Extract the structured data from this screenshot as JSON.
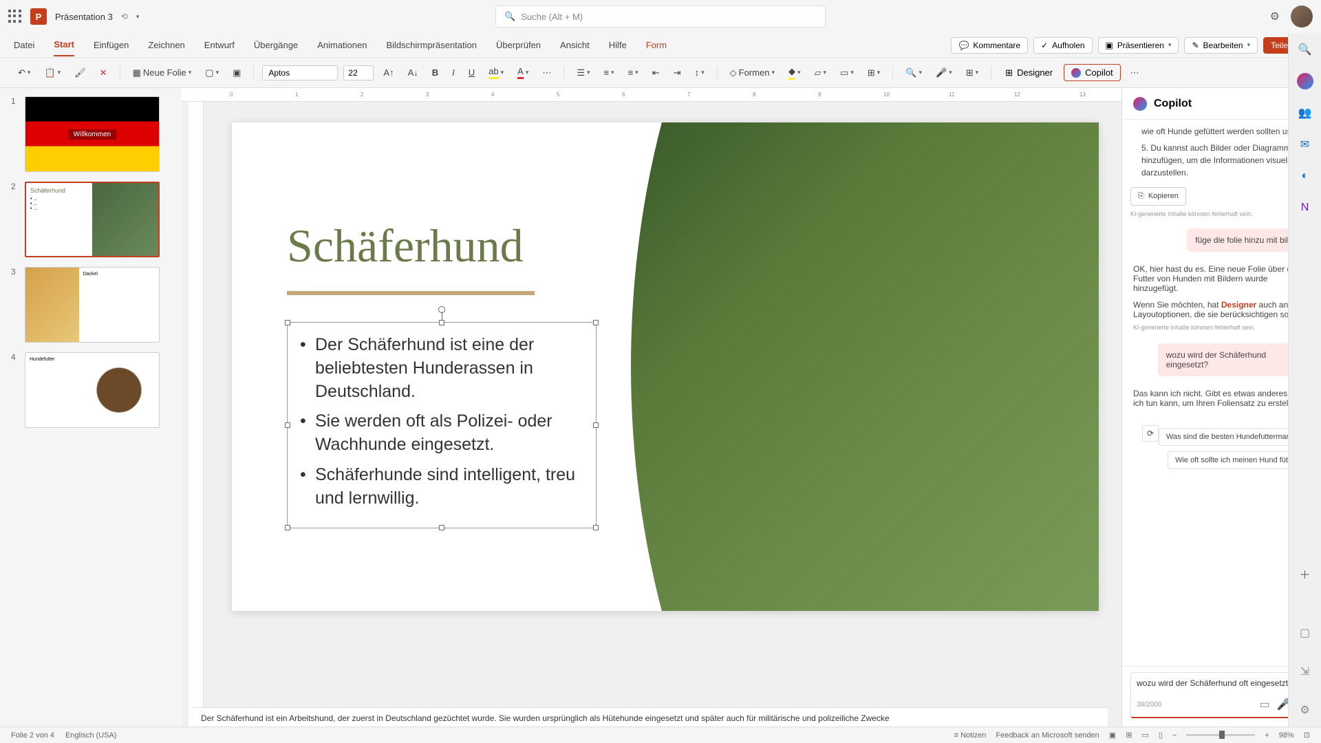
{
  "titlebar": {
    "doc_title": "Präsentation 3",
    "search_placeholder": "Suche (Alt + M)"
  },
  "tabs": {
    "datei": "Datei",
    "start": "Start",
    "einfuegen": "Einfügen",
    "zeichnen": "Zeichnen",
    "entwurf": "Entwurf",
    "uebergaenge": "Übergänge",
    "animationen": "Animationen",
    "bildschirm": "Bildschirmpräsentation",
    "ueberpruefen": "Überprüfen",
    "ansicht": "Ansicht",
    "hilfe": "Hilfe",
    "form": "Form"
  },
  "tabbar_right": {
    "kommentare": "Kommentare",
    "aufholen": "Aufholen",
    "praesentieren": "Präsentieren",
    "bearbeiten": "Bearbeiten",
    "teilen": "Teilen"
  },
  "ribbon": {
    "neue_folie": "Neue Folie",
    "font": "Aptos",
    "size": "22",
    "formen": "Formen",
    "designer": "Designer",
    "copilot": "Copilot"
  },
  "thumbs": {
    "1": {
      "num": "1",
      "title": "Willkommen"
    },
    "2": {
      "num": "2",
      "title": "Schäferhund"
    },
    "3": {
      "num": "3",
      "title": "Dackel"
    },
    "4": {
      "num": "4",
      "title": "Hundefutter"
    }
  },
  "slide": {
    "title": "Schäferhund",
    "bullets": [
      "Der Schäferhund ist eine der beliebtesten Hunderassen in Deutschland.",
      "Sie werden oft als Polizei- oder Wachhunde eingesetzt.",
      "Schäferhunde sind intelligent, treu und lernwillig."
    ]
  },
  "notes": "Der Schäferhund ist ein Arbeitshund, der zuerst in Deutschland gezüchtet wurde. Sie wurden ursprünglich als Hütehunde eingesetzt und später auch für militärische und polizeiliche Zwecke",
  "copilot": {
    "title": "Copilot",
    "list_item4": "wie oft Hunde gefüttert werden sollten usw.",
    "list_item5": "Du kannst auch Bilder oder Diagramme hinzufügen, um die Informationen visuell darzustellen.",
    "kopieren": "Kopieren",
    "disclaimer": "KI-generierte Inhalte könnten fehlerhaft sein.",
    "user1": "füge die folie hinzu mit bildern",
    "asst2a": "OK, hier hast du es. Eine neue Folie über das Futter von Hunden mit Bildern wurde hinzugefügt.",
    "asst2b_pre": "Wenn Sie möchten, hat ",
    "asst2b_link": "Designer",
    "asst2b_post": " auch andere Layoutoptionen, die sie berücksichtigen sollten.",
    "user2": "wozu wird der Schäferhund eingesetzt?",
    "asst3": "Das kann ich nicht. Gibt es etwas anderes, das ich tun kann, um Ihren Foliensatz zu erstellen?",
    "sugg1": "Was sind die besten Hundefuttermarken?",
    "sugg2": "Wie oft sollte ich meinen Hund füttern?",
    "input": "wozu wird der Schäferhund oft eingesetzt",
    "count": "39/2000"
  },
  "status": {
    "slide": "Folie 2 von 4",
    "lang": "Englisch (USA)",
    "notizen": "Notizen",
    "feedback": "Feedback an Microsoft senden",
    "zoom": "98%"
  },
  "ruler": {
    "0": "0",
    "1": "1",
    "2": "2",
    "3": "3",
    "4": "4",
    "5": "5",
    "6": "6",
    "7": "7",
    "8": "8",
    "9": "9",
    "10": "10",
    "11": "11",
    "12": "12",
    "13": "13"
  }
}
